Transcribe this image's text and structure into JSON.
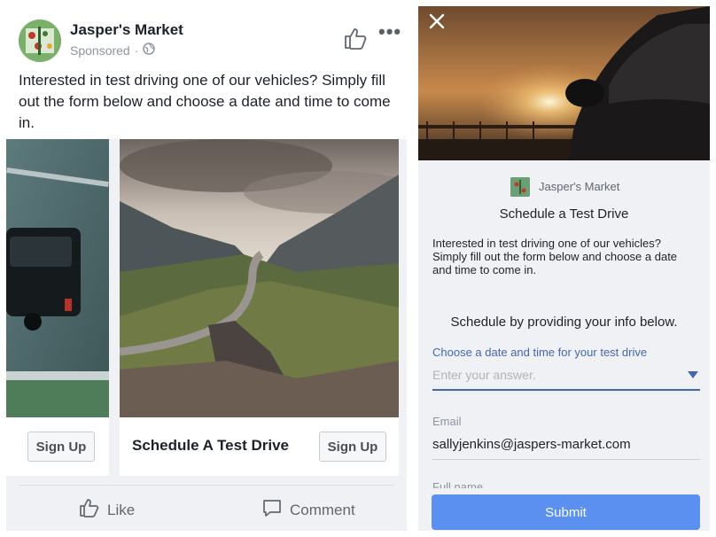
{
  "post": {
    "page_name": "Jasper's Market",
    "sponsored": "Sponsored",
    "sponsored_sep": "·",
    "body_text": "Interested in test driving one of our vehicles? Simply fill out the form below and choose a date and time to come in.",
    "more_icon": "more-dots-icon"
  },
  "carousel": {
    "cards": [
      {
        "title": "",
        "cta": "Sign Up"
      },
      {
        "title": "Schedule A Test Drive",
        "cta": "Sign Up"
      }
    ]
  },
  "actions": {
    "like": "Like",
    "comment": "Comment"
  },
  "form": {
    "close_icon": "close-icon",
    "page_name": "Jasper's Market",
    "title": "Schedule a Test Drive",
    "intro": "Interested in test driving one of our vehicles? Simply fill out the form below and choose a date and time to come in.",
    "instructions": "Schedule by providing your info below.",
    "q1_label": "Choose a date and time for your test drive",
    "q1_placeholder": "Enter your answer.",
    "email_label": "Email",
    "email_value": "sallyjenkins@jaspers-market.com",
    "fullname_label": "Full name",
    "submit": "Submit"
  },
  "colors": {
    "accent": "#4267b2",
    "submit": "#5b8ff0",
    "background": "#f0f1f4"
  }
}
